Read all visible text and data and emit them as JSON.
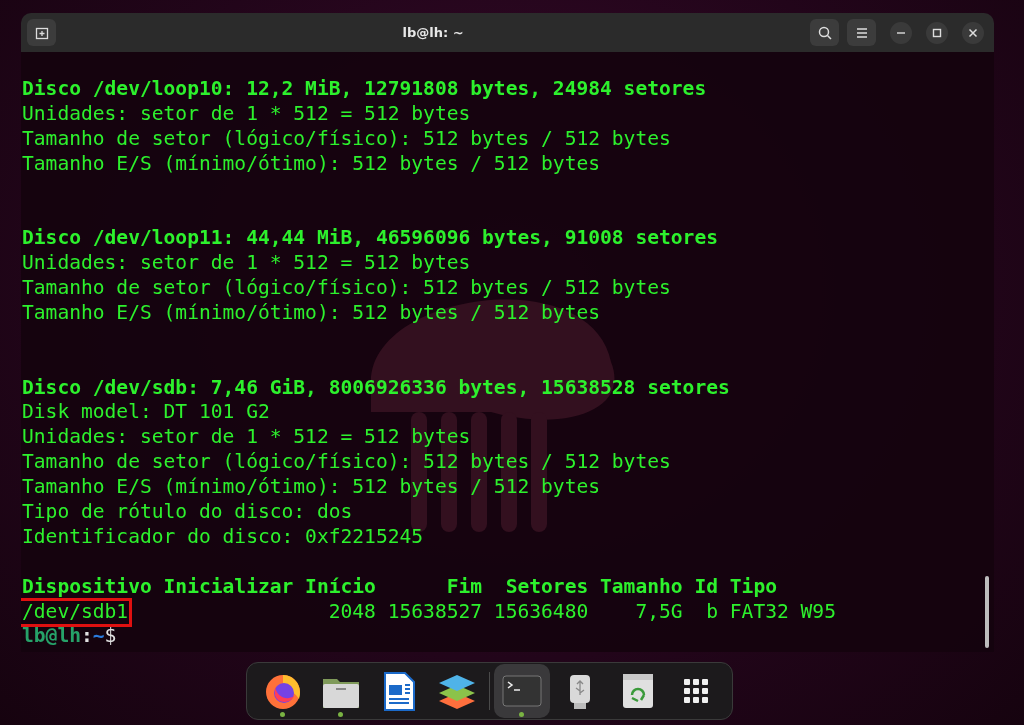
{
  "window": {
    "title": "lb@lh: ~"
  },
  "terminal": {
    "lines": [
      {
        "kind": "blank"
      },
      {
        "kind": "bold",
        "text": "Disco /dev/loop10: 12,2 MiB, 12791808 bytes, 24984 setores"
      },
      {
        "kind": "normal",
        "text": "Unidades: setor de 1 * 512 = 512 bytes"
      },
      {
        "kind": "normal",
        "text": "Tamanho de setor (lógico/físico): 512 bytes / 512 bytes"
      },
      {
        "kind": "normal",
        "text": "Tamanho E/S (mínimo/ótimo): 512 bytes / 512 bytes"
      },
      {
        "kind": "blank"
      },
      {
        "kind": "blank"
      },
      {
        "kind": "bold",
        "text": "Disco /dev/loop11: 44,44 MiB, 46596096 bytes, 91008 setores"
      },
      {
        "kind": "normal",
        "text": "Unidades: setor de 1 * 512 = 512 bytes"
      },
      {
        "kind": "normal",
        "text": "Tamanho de setor (lógico/físico): 512 bytes / 512 bytes"
      },
      {
        "kind": "normal",
        "text": "Tamanho E/S (mínimo/ótimo): 512 bytes / 512 bytes"
      },
      {
        "kind": "blank"
      },
      {
        "kind": "blank"
      },
      {
        "kind": "bold",
        "text": "Disco /dev/sdb: 7,46 GiB, 8006926336 bytes, 15638528 setores"
      },
      {
        "kind": "normal",
        "text": "Disk model: DT 101 G2"
      },
      {
        "kind": "normal",
        "text": "Unidades: setor de 1 * 512 = 512 bytes"
      },
      {
        "kind": "normal",
        "text": "Tamanho de setor (lógico/físico): 512 bytes / 512 bytes"
      },
      {
        "kind": "normal",
        "text": "Tamanho E/S (mínimo/ótimo): 512 bytes / 512 bytes"
      },
      {
        "kind": "normal",
        "text": "Tipo de rótulo do disco: dos"
      },
      {
        "kind": "normal",
        "text": "Identificador do disco: 0xf2215245"
      },
      {
        "kind": "blank"
      },
      {
        "kind": "bold",
        "text": "Dispositivo Inicializar Início      Fim  Setores Tamanho Id Tipo"
      },
      {
        "kind": "highlighted",
        "marked": "/dev/sdb1",
        "text": "                 2048 15638527 15636480    7,5G  b FAT32 W95"
      },
      {
        "kind": "prompt",
        "user": "lb@lh",
        "separator": ":",
        "path": "~",
        "symbol": "$"
      }
    ]
  },
  "dock": {
    "items": [
      {
        "kind": "firefox",
        "running": true,
        "selected": false
      },
      {
        "kind": "files",
        "running": true,
        "selected": false
      },
      {
        "kind": "writer",
        "running": false,
        "selected": false
      },
      {
        "kind": "layers",
        "running": false,
        "selected": false
      },
      {
        "kind": "separator"
      },
      {
        "kind": "terminal",
        "running": true,
        "selected": true
      },
      {
        "kind": "usb",
        "running": false,
        "selected": false
      },
      {
        "kind": "trash",
        "running": false,
        "selected": false
      },
      {
        "kind": "grid",
        "running": false,
        "selected": false
      }
    ]
  }
}
